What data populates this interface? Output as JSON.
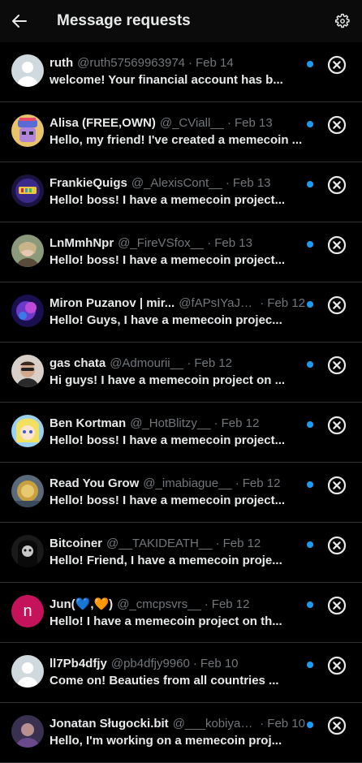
{
  "header": {
    "title": "Message requests"
  },
  "icons": {
    "back": "arrow-left-icon",
    "settings": "gear-icon",
    "dismiss": "circle-x-icon"
  },
  "colors": {
    "unread_dot": "#1d9bf0",
    "background": "#000000",
    "muted": "#71767b"
  },
  "requests": [
    {
      "name": "ruth",
      "handle": "@ruth57569963974",
      "date": "Feb 14",
      "preview": "welcome! Your financial account has b...",
      "avatar": "default"
    },
    {
      "name": "Alisa (FREE,OWN)",
      "handle": "@_CViall__",
      "date": "Feb 13",
      "preview": "Hello, my friend! I've created a memecoin ...",
      "avatar": "cartoon"
    },
    {
      "name": "FrankieQuigs",
      "handle": "@_AlexisCont__",
      "date": "Feb 13",
      "preview": "Hello! boss! I have a memecoin project...",
      "avatar": "logo"
    },
    {
      "name": "LnMmhNpr",
      "handle": "@_FireVSfox__",
      "date": "Feb 13",
      "preview": "Hello! boss! I have a memecoin project...",
      "avatar": "photo"
    },
    {
      "name": "Miron Puzanov | mir...",
      "handle": "@fAPsIYaJ1...",
      "date": "Feb 12",
      "preview": "Hello! Guys, I have a memecoin projec...",
      "avatar": "galaxy"
    },
    {
      "name": "gas chata",
      "handle": "@Admourii__",
      "date": "Feb 12",
      "preview": "Hi guys! I have a memecoin project on ...",
      "avatar": "photo2"
    },
    {
      "name": "Ben Kortman",
      "handle": "@_HotBlitzy__",
      "date": "Feb 12",
      "preview": "Hello! boss! I have a memecoin project...",
      "avatar": "anime"
    },
    {
      "name": "Read You Grow",
      "handle": "@_imabiague__",
      "date": "Feb 12",
      "preview": "Hello! boss! I have a memecoin project...",
      "avatar": "gold"
    },
    {
      "name": "Bitcoiner",
      "handle": "@__TAKIDEATH__",
      "date": "Feb 12",
      "preview": "Hello! Friend, I have a memecoin proje...",
      "avatar": "dark"
    },
    {
      "name": "Jun(💙,🧡)",
      "handle": "@_cmcpsvrs__",
      "date": "Feb 12",
      "preview": "Hello! I have a memecoin project on th...",
      "avatar": "initial",
      "initial": "n"
    },
    {
      "name": "ll7Pb4dfjy",
      "handle": "@pb4dfjy9960",
      "date": "Feb 10",
      "preview": "Come on! Beauties from all countries ...",
      "avatar": "default"
    },
    {
      "name": "Jonatan Sługocki.bit",
      "handle": "@___kobiyagi_",
      "date": "Feb 10",
      "preview": "Hello, I'm working on a memecoin proj...",
      "avatar": "purple"
    }
  ]
}
